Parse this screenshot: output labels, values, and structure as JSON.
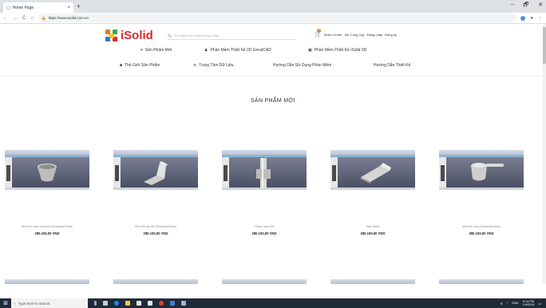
{
  "browser": {
    "tab_title": "Home Page",
    "tab_close": "×",
    "new_tab": "+",
    "url": "https://www.isolid.com.vn",
    "window_controls": [
      "–",
      "🗗",
      "✕"
    ]
  },
  "header": {
    "logo_text": "iSolid",
    "search_placeholder": "Tìm kiếm sản phẩm trong ô đây...",
    "cart_count": "0",
    "top_links": [
      "iSolid Center",
      "Mở Cung Cấp",
      "Đăng nhập",
      "Đăng ký"
    ],
    "nav_row1": [
      "Sản Phẩm Mới",
      "Phần Mềm Thiết Kế 2D GreatCAD",
      "Phần Mềm Thiết Kế iSolid 3D"
    ],
    "nav_row2": [
      "Thế Giới Sản Phẩm",
      "Trung Tâm Dữ Liệu",
      "Hướng Dẫn Sử Dụng Phần Mềm",
      "Hướng Dẫn Thiết Kế"
    ]
  },
  "section_title": "SẢN PHẨM MỚI",
  "products": [
    {
      "name": "Mô hình chậu hoa tròn (Download Now)",
      "price": "280.150,00 VND"
    },
    {
      "name": "Mô hình giá đỡ (Download Now)",
      "price": "280.150,00 VND"
    },
    {
      "name": "Thanh trượt đôi",
      "price": "280.150,00 VND"
    },
    {
      "name": "Hộp Nhựa",
      "price": "280.150,00 VND"
    },
    {
      "name": "Mô hình Vạc (Download Now)",
      "price": "280.150,00 VND"
    }
  ],
  "taskbar": {
    "search_placeholder": "Type here to search",
    "lang": "ENG",
    "time": "6:11 PM",
    "date": "1/9/2019"
  },
  "colors": {
    "brand": "#e0282a",
    "viewport_bg": "#5b5f73",
    "taskbar": "#1f2a38"
  }
}
